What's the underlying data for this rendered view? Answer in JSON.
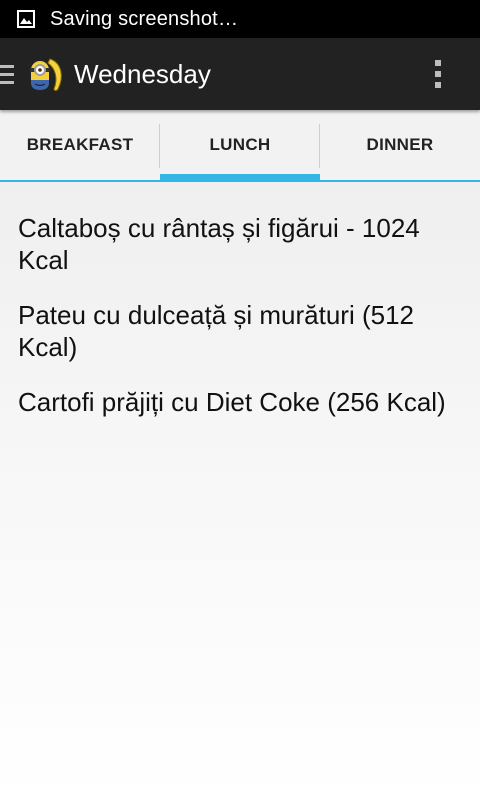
{
  "status_bar": {
    "notification_icon": "image-icon",
    "text": "Saving screenshot…"
  },
  "action_bar": {
    "title": "Wednesday",
    "drawer_icon": "drawer-menu-icon",
    "app_icon": "minion-app-icon",
    "overflow_icon": "overflow-menu-icon"
  },
  "tabs": [
    {
      "label": "BREAKFAST",
      "selected": false
    },
    {
      "label": "LUNCH",
      "selected": true
    },
    {
      "label": "DINNER",
      "selected": false
    }
  ],
  "meals": [
    "Caltaboș cu rântaș și figărui - 1024 Kcal",
    "Pateu cu dulceață și murături (512 Kcal)",
    "Cartofi prăjiți cu Diet Coke (256 Kcal)"
  ],
  "colors": {
    "accent": "#33b5e5",
    "action_bar": "#222222",
    "status_bar": "#000000"
  }
}
